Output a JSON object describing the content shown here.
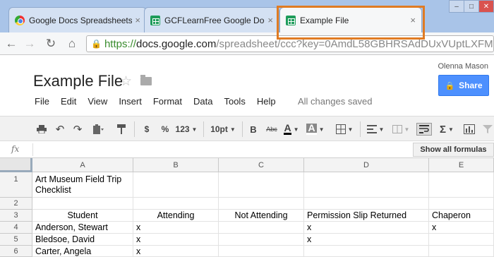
{
  "browser": {
    "tabs": [
      {
        "label": "Google Docs Spreadsheets:",
        "icon": "chrome-icon",
        "active": false
      },
      {
        "label": "GCFLearnFree Google Docs",
        "icon": "sheets-icon",
        "active": false
      },
      {
        "label": "Example File",
        "icon": "sheets-icon",
        "active": true
      }
    ],
    "close_glyph": "×",
    "window_min": "–",
    "window_max": "□",
    "window_close": "✕",
    "url": {
      "scheme": "https://",
      "host": "docs.google.com",
      "path": "/spreadsheet/ccc?key=0AmdL58GBHRSAdDUxVUptLXFM"
    },
    "nav": {
      "back": "←",
      "forward": "→",
      "reload": "↻",
      "home": "⌂"
    }
  },
  "doc": {
    "title": "Example File",
    "user": "Olenna Mason",
    "share_label": "Share",
    "save_status": "All changes saved",
    "menu": [
      "File",
      "Edit",
      "View",
      "Insert",
      "Format",
      "Data",
      "Tools",
      "Help"
    ]
  },
  "toolbar": {
    "currency": "$",
    "percent": "%",
    "number_format": "123",
    "font_size": "10pt",
    "bold": "B",
    "strike": "Abc",
    "text_color": "A",
    "fill_color": "A",
    "sum": "Σ"
  },
  "formula_bar": {
    "fx": "fx",
    "show_all_formulas": "Show all formulas"
  },
  "sheet": {
    "columns": [
      "A",
      "B",
      "C",
      "D",
      "E"
    ],
    "rows": [
      {
        "num": "1",
        "cells": [
          "Art Museum Field Trip Checklist",
          "",
          "",
          "",
          ""
        ]
      },
      {
        "num": "2",
        "cells": [
          "",
          "",
          "",
          "",
          ""
        ]
      },
      {
        "num": "3",
        "cells": [
          "Student",
          "Attending",
          "Not Attending",
          "Permission Slip Returned",
          "Chaperon"
        ]
      },
      {
        "num": "4",
        "cells": [
          "Anderson, Stewart",
          "x",
          "",
          "x",
          "x"
        ]
      },
      {
        "num": "5",
        "cells": [
          "Bledsoe, David",
          "x",
          "",
          "x",
          ""
        ]
      },
      {
        "num": "6",
        "cells": [
          "Carter, Angela",
          "x",
          "",
          "",
          ""
        ]
      }
    ]
  },
  "colors": {
    "tab_highlight": "#e07b23",
    "share_button": "#4d90fe",
    "url_secure": "#3a8c2e"
  }
}
